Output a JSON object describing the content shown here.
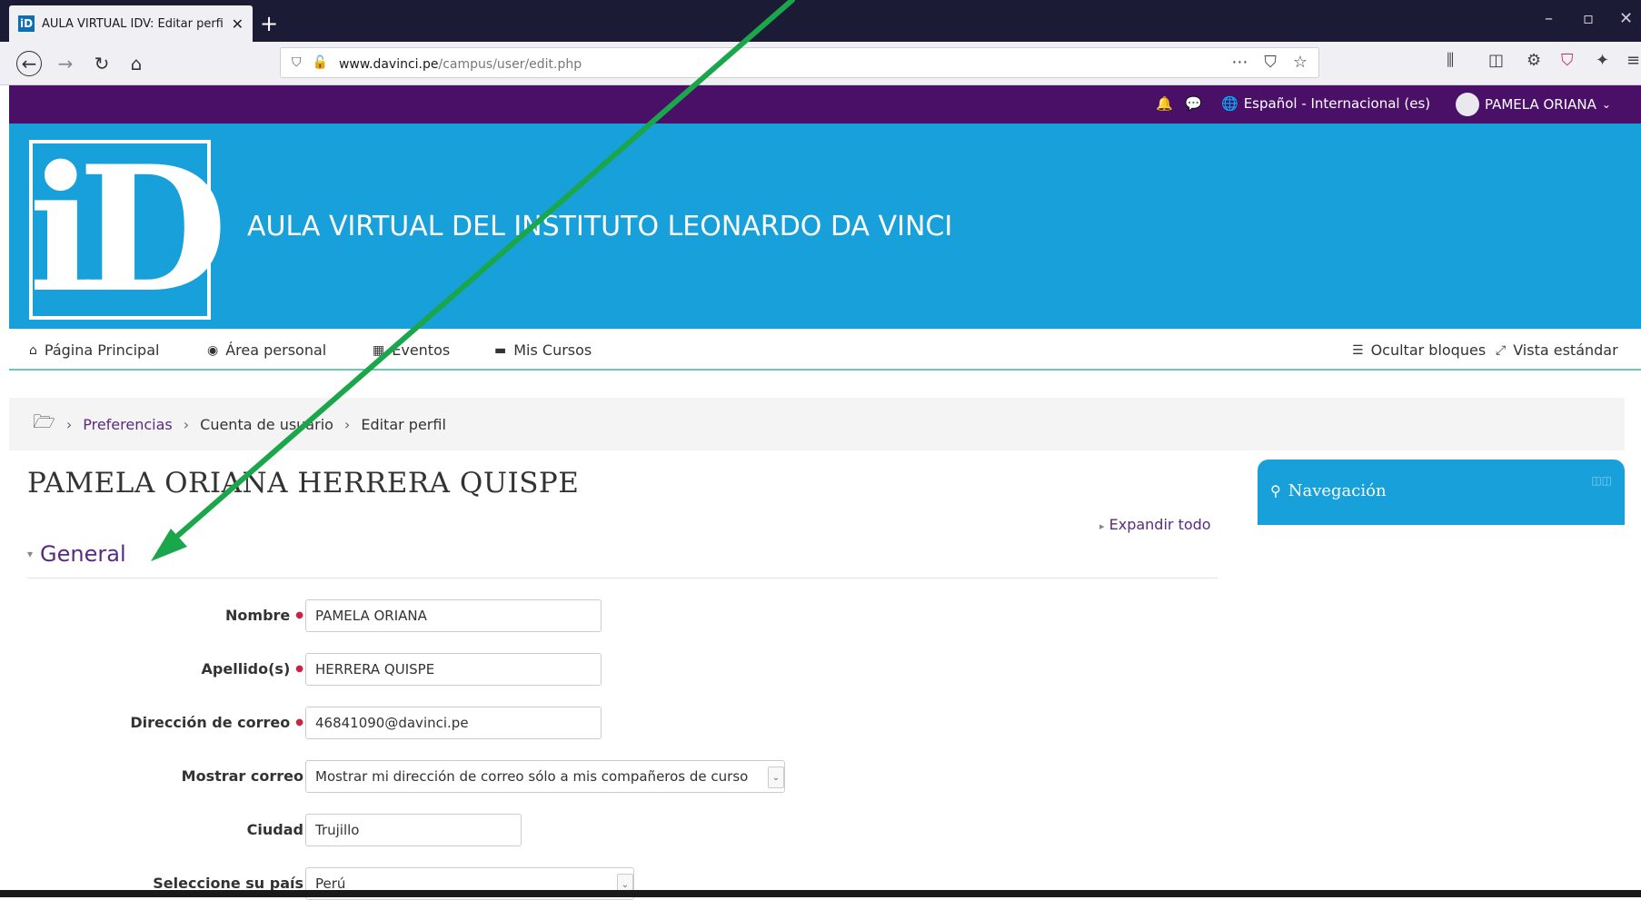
{
  "browser": {
    "tab_title": "AULA VIRTUAL IDV: Editar perfil",
    "tab_favicon_text": "iD",
    "url_host": "www.davinci.pe",
    "url_path": "/campus/user/edit.php"
  },
  "userbar": {
    "language": "Español - Internacional (es)",
    "user_name": "PAMELA ORIANA"
  },
  "header": {
    "logo_text": "iD",
    "site_title": "AULA VIRTUAL DEL INSTITUTO LEONARDO DA VINCI"
  },
  "mainnav": {
    "items": [
      {
        "label": "Página Principal",
        "icon": "home-icon"
      },
      {
        "label": "Área personal",
        "icon": "dashboard-icon"
      },
      {
        "label": "Eventos",
        "icon": "calendar-icon"
      },
      {
        "label": "Mis Cursos",
        "icon": "briefcase-icon"
      }
    ],
    "hide_blocks": "Ocultar bloques",
    "standard_view": "Vista estándar"
  },
  "breadcrumb": {
    "items": [
      "Preferencias",
      "Cuenta de usuario",
      "Editar perfil"
    ]
  },
  "page": {
    "title": "PAMELA ORIANA HERRERA QUISPE",
    "expand_all": "Expandir todo",
    "section": "General"
  },
  "form": {
    "nombre_label": "Nombre",
    "nombre_value": "PAMELA ORIANA",
    "apellido_label": "Apellido(s)",
    "apellido_value": "HERRERA QUISPE",
    "email_label": "Dirección de correo",
    "email_value": "46841090@davinci.pe",
    "mostrar_label": "Mostrar correo",
    "mostrar_value": "Mostrar mi dirección de correo sólo a mis compañeros de curso",
    "ciudad_label": "Ciudad",
    "ciudad_value": "Trujillo",
    "pais_label": "Seleccione su país",
    "pais_value": "Perú"
  },
  "nav_block": {
    "title": "Navegación"
  },
  "colors": {
    "userbar": "#4a1068",
    "banner": "#18a0db",
    "link": "#5a2a7e",
    "arrow": "#1aa64a"
  }
}
